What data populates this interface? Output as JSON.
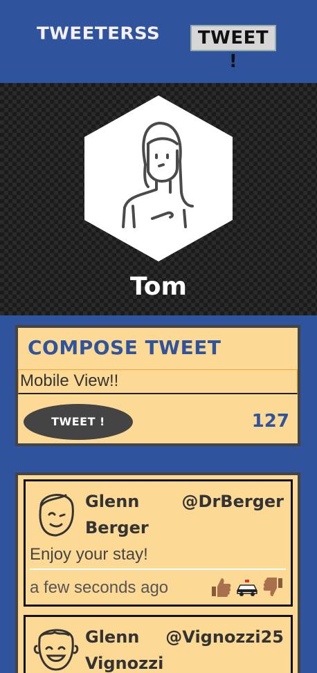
{
  "nav": {
    "brand": "TWEETERSS",
    "tweet_button": "TWEET !"
  },
  "profile": {
    "name": "Tom",
    "avatar_icon": "user-avatar-icon"
  },
  "compose": {
    "title": "COMPOSE TWEET",
    "input_value": "Mobile View!!",
    "button_label": "TWEET !",
    "char_count": "127"
  },
  "feed": {
    "tweets": [
      {
        "name": "Glenn Berger",
        "handle": "@DrBerger",
        "body": "Enjoy your stay!",
        "time": "a few seconds ago",
        "actions": [
          "thumbs-up-icon",
          "police-car-icon",
          "thumbs-down-icon"
        ]
      },
      {
        "name": "Glenn Vignozzi",
        "handle": "@Vignozzi25"
      }
    ]
  },
  "colors": {
    "background": "#2f539d",
    "card": "#fdd996",
    "accent": "#2f539d",
    "button": "#444444"
  }
}
